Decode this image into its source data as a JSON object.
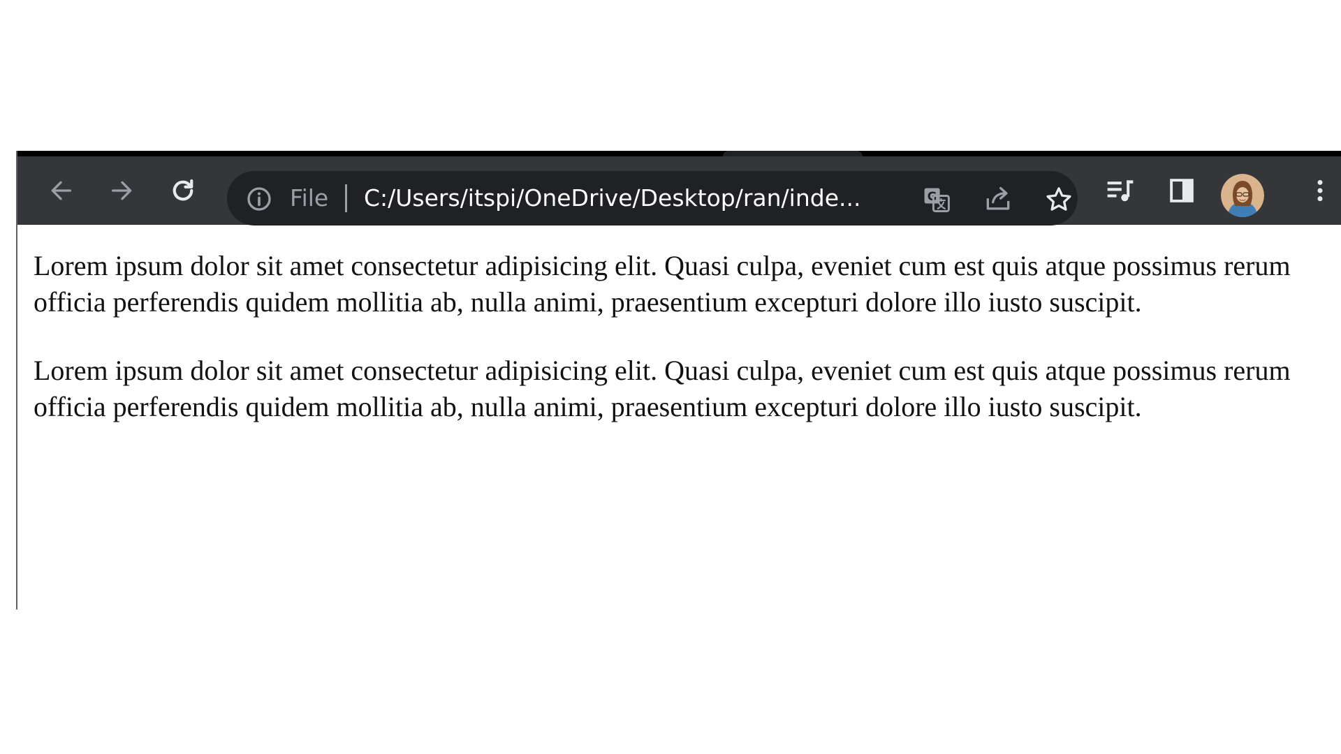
{
  "browser": {
    "omnibox": {
      "chip_label": "File",
      "url": "C:/Users/itspi/OneDrive/Desktop/ran/inde..."
    },
    "icons": {
      "back": "arrow-left-icon",
      "forward": "arrow-right-icon",
      "reload": "reload-icon",
      "info": "info-icon",
      "translate": "translate-icon",
      "share": "share-icon",
      "bookmark": "star-icon",
      "media": "media-controls-icon",
      "side_panel": "side-panel-icon",
      "profile": "profile-avatar",
      "menu": "kebab-menu-icon"
    },
    "colors": {
      "toolbar_bg": "#35363a",
      "omnibox_bg": "#202124",
      "icon_active": "#e8eaed",
      "icon_inactive": "#9aa0a6"
    }
  },
  "page": {
    "paragraphs": [
      "Lorem ipsum dolor sit amet consectetur adipisicing elit. Quasi culpa, eveniet cum est quis atque possimus rerum officia perferendis quidem mollitia ab, nulla animi, praesentium excepturi dolore illo iusto suscipit.",
      "Lorem ipsum dolor sit amet consectetur adipisicing elit. Quasi culpa, eveniet cum est quis atque possimus rerum officia perferendis quidem mollitia ab, nulla animi, praesentium excepturi dolore illo iusto suscipit."
    ]
  }
}
